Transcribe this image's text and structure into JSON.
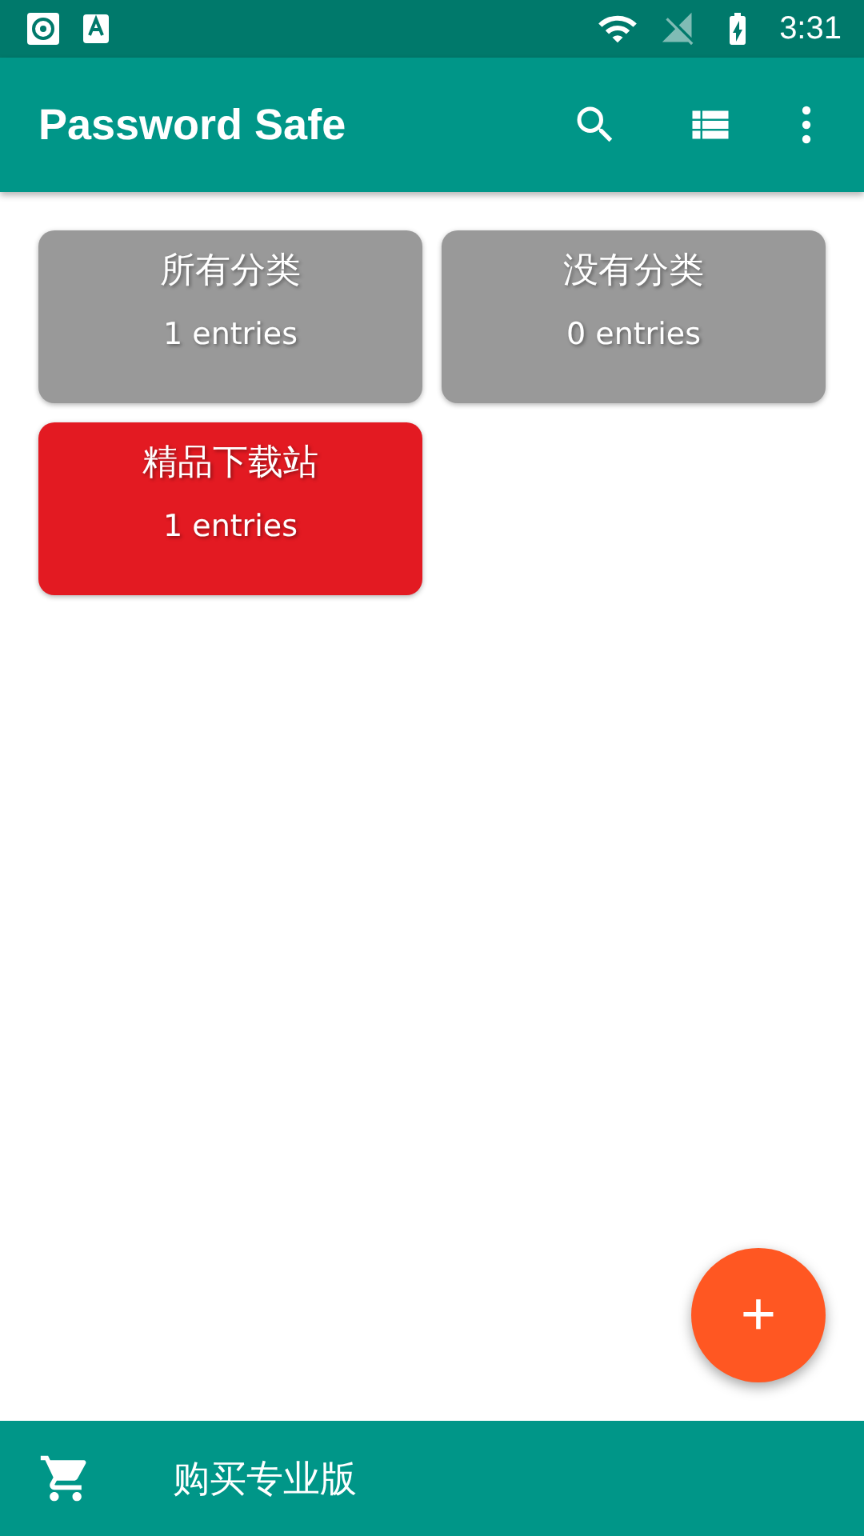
{
  "status_bar": {
    "time": "3:31"
  },
  "app_bar": {
    "title": "Password Safe"
  },
  "categories": [
    {
      "name": "所有分类",
      "count": "1 entries",
      "color": "#999999"
    },
    {
      "name": "没有分类",
      "count": "0 entries",
      "color": "#999999"
    },
    {
      "name": "精品下载站",
      "count": "1 entries",
      "color": "#e31a22"
    }
  ],
  "fab": {
    "label": "+"
  },
  "bottom_bar": {
    "label": "购买专业版"
  }
}
